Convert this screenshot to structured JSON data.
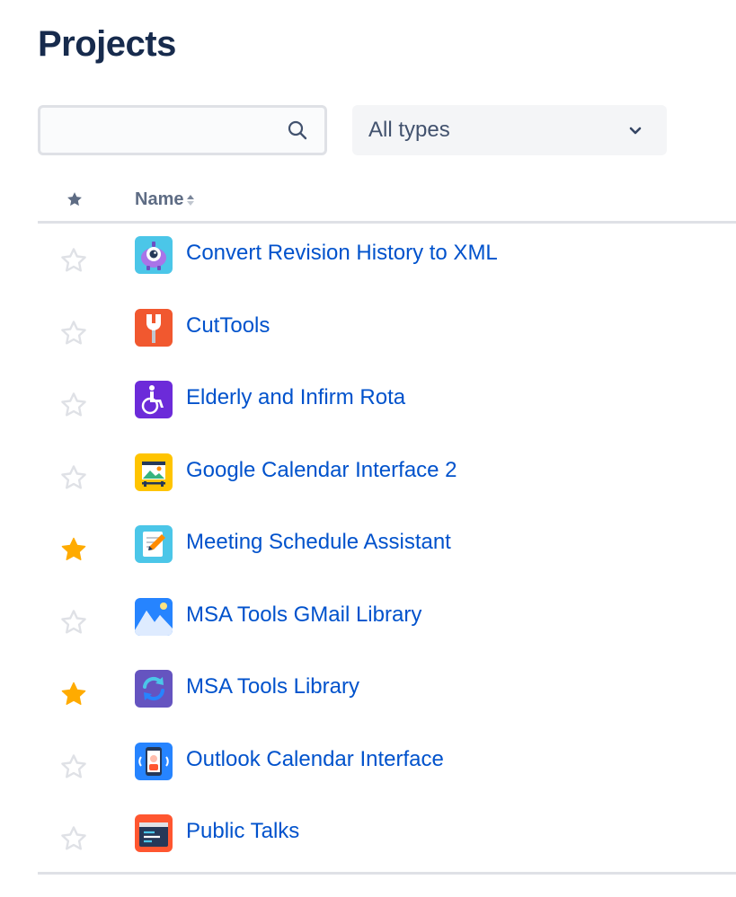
{
  "page": {
    "title": "Projects"
  },
  "filters": {
    "search_value": "",
    "search_placeholder": "",
    "type_select": {
      "selected": "All types"
    }
  },
  "table": {
    "columns": {
      "star_header_icon": "star-icon",
      "name": "Name",
      "sort": "ascending"
    },
    "rows": [
      {
        "name": "Convert Revision History to XML",
        "starred": false,
        "icon": "robot-avatar-icon"
      },
      {
        "name": "CutTools",
        "starred": false,
        "icon": "wrench-icon"
      },
      {
        "name": "Elderly and Infirm Rota",
        "starred": false,
        "icon": "wheelchair-icon"
      },
      {
        "name": "Google Calendar Interface 2",
        "starred": false,
        "icon": "calendar-picture-icon"
      },
      {
        "name": "Meeting Schedule Assistant",
        "starred": true,
        "icon": "notepad-pencil-icon"
      },
      {
        "name": "MSA Tools GMail Library",
        "starred": false,
        "icon": "mountain-icon"
      },
      {
        "name": "MSA Tools Library",
        "starred": true,
        "icon": "refresh-arrows-icon"
      },
      {
        "name": "Outlook Calendar Interface",
        "starred": false,
        "icon": "phone-person-icon"
      },
      {
        "name": "Public Talks",
        "starred": false,
        "icon": "code-window-icon"
      }
    ]
  },
  "colors": {
    "title": "#172b4d",
    "link": "#0052cc",
    "star_filled": "#ffab00",
    "star_empty": "#dfe1e6",
    "header_text": "#5e6c84",
    "divider": "#dfe1e6"
  }
}
